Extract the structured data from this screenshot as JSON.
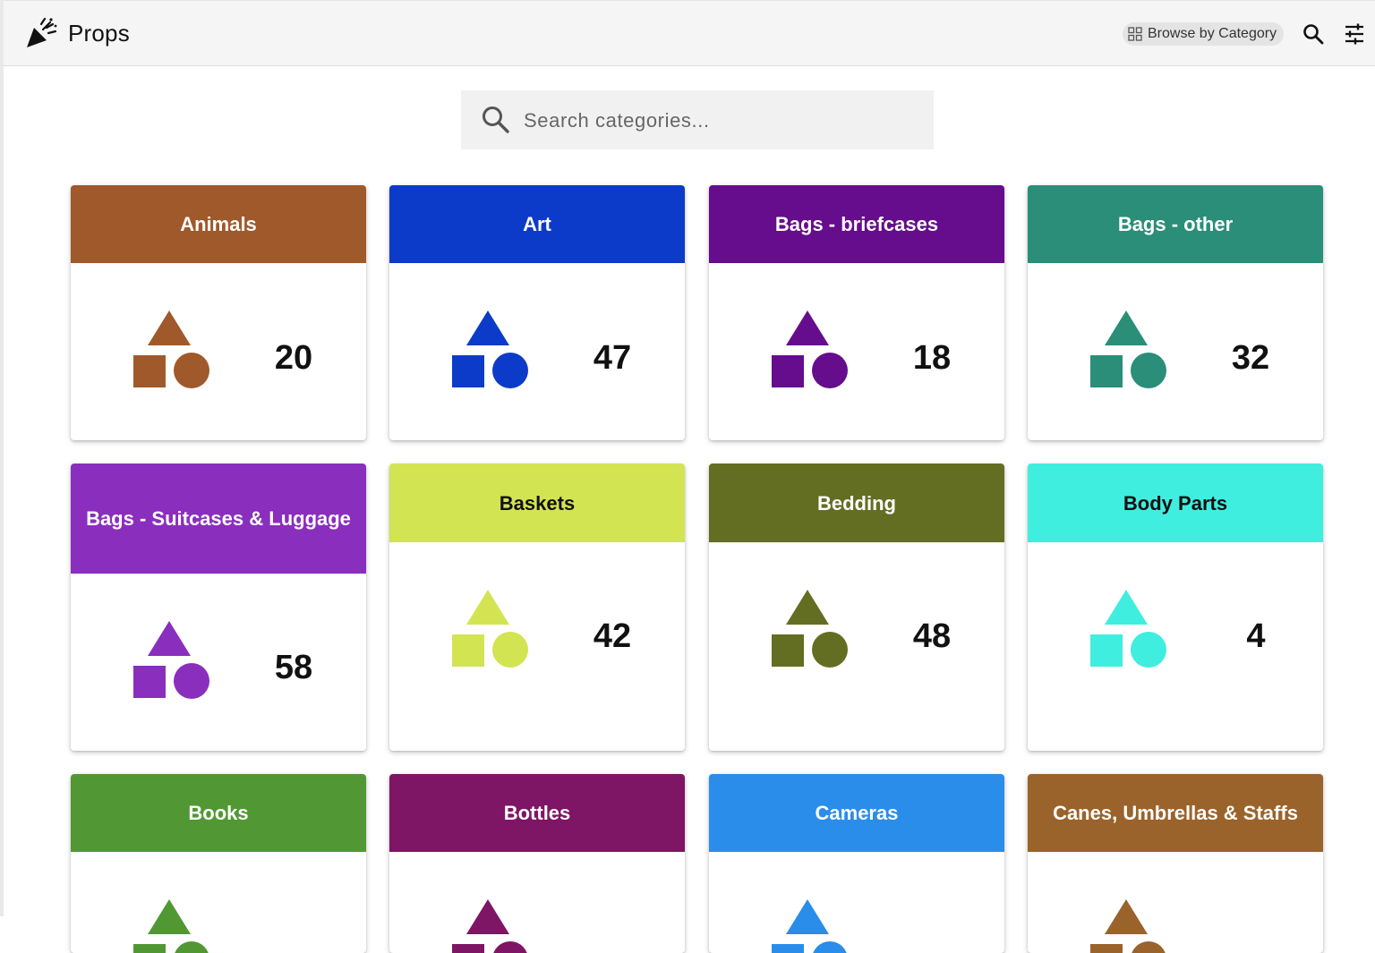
{
  "app": {
    "title": "Props",
    "browse_label": "Browse by Category"
  },
  "search": {
    "placeholder": "Search categories..."
  },
  "categories": [
    {
      "name": "Animals",
      "count": "20",
      "color": "#A0592A",
      "text_color": "#ffffff"
    },
    {
      "name": "Art",
      "count": "47",
      "color": "#0D3BC9",
      "text_color": "#ffffff"
    },
    {
      "name": "Bags - briefcases",
      "count": "18",
      "color": "#650D8C",
      "text_color": "#ffffff"
    },
    {
      "name": "Bags - other",
      "count": "32",
      "color": "#2A8E78",
      "text_color": "#ffffff"
    },
    {
      "name": "Bags - Suitcases & Luggage",
      "count": "58",
      "color": "#8A2EBE",
      "text_color": "#ffffff"
    },
    {
      "name": "Baskets",
      "count": "42",
      "color": "#D3E452",
      "text_color": "#111111"
    },
    {
      "name": "Bedding",
      "count": "48",
      "color": "#646E22",
      "text_color": "#ffffff"
    },
    {
      "name": "Body Parts",
      "count": "4",
      "color": "#3FEEDF",
      "text_color": "#111111"
    },
    {
      "name": "Books",
      "count": "",
      "color": "#519834",
      "text_color": "#ffffff"
    },
    {
      "name": "Bottles",
      "count": "",
      "color": "#7E1565",
      "text_color": "#ffffff"
    },
    {
      "name": "Cameras",
      "count": "",
      "color": "#2A8DEA",
      "text_color": "#ffffff"
    },
    {
      "name": "Canes, Umbrellas & Staffs",
      "count": "",
      "color": "#9A632B",
      "text_color": "#ffffff"
    }
  ]
}
